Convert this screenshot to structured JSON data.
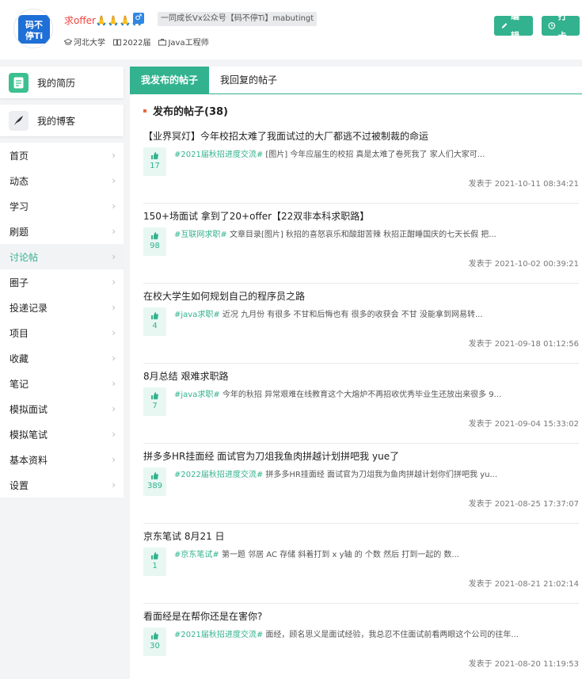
{
  "user": {
    "avatar_text": "码不停Ti",
    "name": "求offer🙏🙏🙏🙏",
    "gender_symbol": "♂",
    "slogan": "一同成长Vx公众号【码不停Ti】mabutingt",
    "school": "河北大学",
    "grade": "2022届",
    "job": "Java工程师"
  },
  "actions": {
    "edit_label": "编辑",
    "checkin_label": "打卡"
  },
  "sidebar": {
    "cards": [
      {
        "label": "我的简历"
      },
      {
        "label": "我的博客"
      }
    ],
    "menu": [
      {
        "label": "首页"
      },
      {
        "label": "动态"
      },
      {
        "label": "学习"
      },
      {
        "label": "刷题"
      },
      {
        "label": "讨论帖",
        "active": true
      },
      {
        "label": "圈子"
      },
      {
        "label": "投递记录"
      },
      {
        "label": "项目"
      },
      {
        "label": "收藏"
      },
      {
        "label": "笔记"
      },
      {
        "label": "模拟面试"
      },
      {
        "label": "模拟笔试"
      },
      {
        "label": "基本资料"
      },
      {
        "label": "设置"
      }
    ]
  },
  "tabs": [
    {
      "label": "我发布的帖子",
      "active": true
    },
    {
      "label": "我回复的帖子"
    }
  ],
  "section": {
    "title": "发布的帖子(38)"
  },
  "posts": [
    {
      "title": "【业界冥灯】今年校招太难了我面试过的大厂都逃不过被制裁的命运",
      "likes": "17",
      "tag": "#2021届秋招进度交流#",
      "excerpt": " [图片] 今年应届生的校招 真是太难了卷死我了 家人们大家可...",
      "date": "发表于 2021-10-11 08:34:21"
    },
    {
      "title": "150+场面试 拿到了20+offer【22双非本科求职路】",
      "likes": "98",
      "tag": "#互联网求职#",
      "excerpt": " 文章目录[图片] 秋招的喜怒哀乐和酸甜苦辣 秋招正酣睡国庆的七天长假 把...",
      "date": "发表于 2021-10-02 00:39:21"
    },
    {
      "title": "在校大学生如何规划自己的程序员之路",
      "likes": "4",
      "tag": "#java求职#",
      "excerpt": " 近况 九月份 有很多 不甘和后悔也有 很多的收获会 不甘 没能拿到网易转...",
      "date": "发表于 2021-09-18 01:12:56"
    },
    {
      "title": "8月总结 艰难求职路",
      "likes": "7",
      "tag": "#java求职#",
      "excerpt": " 今年的秋招 异常艰难在线教育这个大熔炉不再招收优秀毕业生还放出来很多 9...",
      "date": "发表于 2021-09-04 15:33:02"
    },
    {
      "title": "拼多多HR挂面经 面试官为刀俎我鱼肉拼越计划拼吧我 yue了",
      "likes": "389",
      "tag": "#2022届秋招进度交流#",
      "excerpt": " 拼多多HR挂面经 面试官为刀俎我为鱼肉拼越计划你们拼吧我 yu...",
      "date": "发表于 2021-08-25 17:37:07"
    },
    {
      "title": "京东笔试 8月21 日",
      "likes": "1",
      "tag": "#京东笔试#",
      "excerpt": " 第一题 邻居 AC 存储 斜着打到 x y轴 的 个数 然后 打到一起的 数...",
      "date": "发表于 2021-08-21 21:02:14"
    },
    {
      "title": "看面经是在帮你还是在害你?",
      "likes": "30",
      "tag": "#2021届秋招进度交流#",
      "excerpt": " 面经，顾名思义是面试经验，我总忍不住面试前看两眼这个公司的往年...",
      "date": "发表于 2021-08-20 11:19:53"
    }
  ]
}
